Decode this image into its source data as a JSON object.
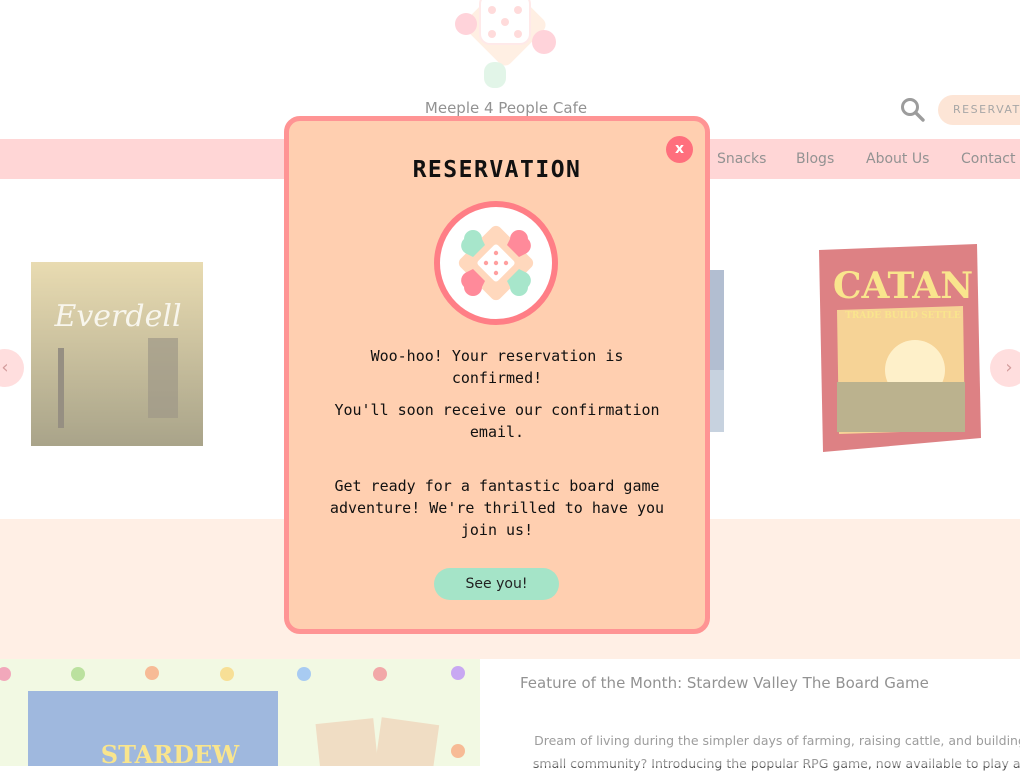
{
  "site": {
    "brand": "Meeple 4 People Cafe",
    "reserve_label": "RESERVATIONS"
  },
  "nav": {
    "items": [
      {
        "label": "Snacks"
      },
      {
        "label": "Blogs"
      },
      {
        "label": "About Us"
      },
      {
        "label": "Contact Us"
      }
    ]
  },
  "carousel": {
    "prev": "‹",
    "next": "›",
    "games": [
      {
        "title": "Everdell"
      },
      {
        "title": "CATAN",
        "subtitle": "TRADE BUILD SETTLE"
      }
    ]
  },
  "feature": {
    "title": "Feature of the Month: Stardew Valley The Board Game",
    "text_line1": "Dream of living during the simpler days of farming, raising cattle, and building",
    "text_line2": "small community? Introducing the popular RPG game, now available to play as",
    "box_title": "STARDEW"
  },
  "modal": {
    "title": "RESERVATION",
    "close_label": "x",
    "message1": "Woo-hoo! Your reservation is confirmed!",
    "message2": "You'll soon receive our confirmation email.",
    "message3": "Get ready for a fantastic board game adventure! We're thrilled to have you join us!",
    "button_label": "See you!"
  },
  "colors": {
    "nav": "#ffb8b8",
    "modal_bg": "#ffcfb0",
    "modal_border": "#ff9494",
    "close": "#ff6f7d",
    "button": "#a5e4c8"
  },
  "icons": [
    "meeple-dice-logo",
    "search-icon",
    "close-icon",
    "chevron-left-icon",
    "chevron-right-icon"
  ]
}
